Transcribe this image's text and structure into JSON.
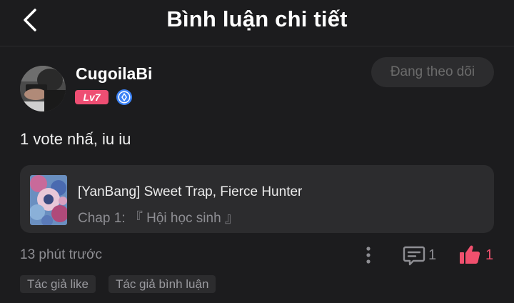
{
  "header": {
    "title": "Bình luận chi tiết",
    "back_icon": "chevron-left-icon"
  },
  "user": {
    "name": "CugoilaBi",
    "level": "Lv7",
    "verify_icon": "diamond-badge-icon",
    "follow_label": "Đang theo dõi"
  },
  "comment": {
    "text": "1 vote nhấ, iu iu"
  },
  "manga_card": {
    "title": "[YanBang] Sweet Trap, Fierce Hunter",
    "chapter": "Chap 1: 『 Hội học sinh 』"
  },
  "footer": {
    "time": "13 phút trước",
    "reply_count": "1",
    "like_count": "1"
  },
  "tags": [
    "Tác giả like",
    "Tác giả bình luận"
  ],
  "colors": {
    "background": "#1c1c1e",
    "surface": "#2c2c2e",
    "accent": "#f0506e",
    "level_badge": "#ee4e73",
    "verify_badge": "#3b82f6",
    "muted_text": "#8e8e93"
  }
}
